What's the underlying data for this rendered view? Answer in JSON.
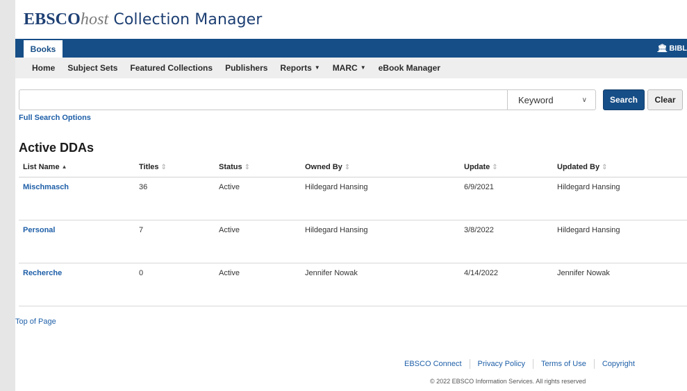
{
  "logo": {
    "brand": "EBSCO",
    "host": "host",
    "rest": " Collection Manager"
  },
  "topbar": {
    "tab": "Books",
    "institution": "BIBL",
    "institution_icon": "bank-icon"
  },
  "nav": {
    "items": [
      {
        "label": "Home",
        "dropdown": false
      },
      {
        "label": "Subject Sets",
        "dropdown": false
      },
      {
        "label": "Featured Collections",
        "dropdown": false
      },
      {
        "label": "Publishers",
        "dropdown": false
      },
      {
        "label": "Reports",
        "dropdown": true
      },
      {
        "label": "MARC",
        "dropdown": true
      },
      {
        "label": "eBook Manager",
        "dropdown": false
      }
    ]
  },
  "search": {
    "value": "",
    "placeholder": "",
    "mode": "Keyword",
    "search_label": "Search",
    "clear_label": "Clear",
    "full_options_label": "Full Search Options"
  },
  "section_title": "Active DDAs",
  "table": {
    "columns": [
      {
        "label": "List Name",
        "sort": "asc"
      },
      {
        "label": "Titles",
        "sort": "none"
      },
      {
        "label": "Status",
        "sort": "none"
      },
      {
        "label": "Owned By",
        "sort": "none"
      },
      {
        "label": "Update",
        "sort": "none"
      },
      {
        "label": "Updated By",
        "sort": "none"
      }
    ],
    "rows": [
      {
        "name": "Mischmasch",
        "titles": "36",
        "status": "Active",
        "owned_by": "Hildegard Hansing",
        "update": "6/9/2021",
        "updated_by": "Hildegard Hansing"
      },
      {
        "name": "Personal",
        "titles": "7",
        "status": "Active",
        "owned_by": "Hildegard Hansing",
        "update": "3/8/2022",
        "updated_by": "Hildegard Hansing"
      },
      {
        "name": "Recherche",
        "titles": "0",
        "status": "Active",
        "owned_by": "Jennifer Nowak",
        "update": "4/14/2022",
        "updated_by": "Jennifer Nowak"
      }
    ]
  },
  "top_of_page": "Top of Page",
  "footer": {
    "links": [
      "EBSCO Connect",
      "Privacy Policy",
      "Terms of Use",
      "Copyright"
    ],
    "copyright": "© 2022 EBSCO Information Services. All rights reserved"
  },
  "colors": {
    "primary": "#164e87",
    "link": "#1e5fa8",
    "nav_bg": "#eeeeee",
    "side_bg": "#e6e6e6"
  }
}
